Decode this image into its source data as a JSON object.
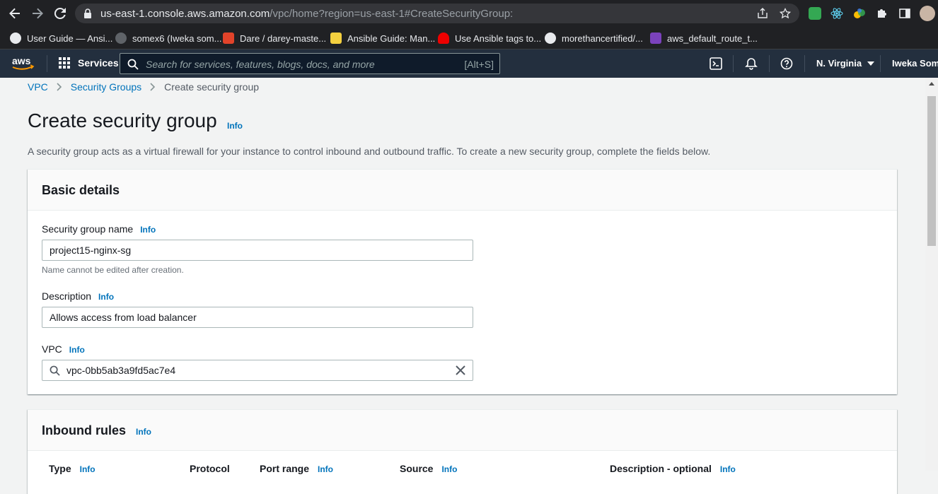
{
  "browser": {
    "url_host": "us-east-1.console.aws.amazon.com",
    "url_path": "/vpc/home?region=us-east-1#CreateSecurityGroup:",
    "bookmarks": [
      {
        "label": "User Guide — Ansi...",
        "icon": "ansible-icon"
      },
      {
        "label": "somex6 (Iweka som...",
        "icon": "github-icon"
      },
      {
        "label": "Dare / darey-maste...",
        "icon": "gitlab-icon"
      },
      {
        "label": "Ansible Guide: Man...",
        "icon": "ribbon-icon"
      },
      {
        "label": "Use Ansible tags to...",
        "icon": "redhat-icon"
      },
      {
        "label": "morethancertified/...",
        "icon": "github-icon"
      },
      {
        "label": "aws_default_route_t...",
        "icon": "terraform-icon"
      }
    ]
  },
  "aws_nav": {
    "services_label": "Services",
    "search_placeholder": "Search for services, features, blogs, docs, and more",
    "search_shortcut": "[Alt+S]",
    "region": "N. Virginia",
    "user": "Iweka Somto"
  },
  "breadcrumb": [
    "VPC",
    "Security Groups",
    "Create security group"
  ],
  "page": {
    "title": "Create security group",
    "info": "Info",
    "description": "A security group acts as a virtual firewall for your instance to control inbound and outbound traffic. To create a new security group, complete the fields below."
  },
  "basic_details": {
    "heading": "Basic details",
    "name_label": "Security group name",
    "name_value": "project15-nginx-sg",
    "name_hint": "Name cannot be edited after creation.",
    "description_label": "Description",
    "description_value": "Allows access from load balancer",
    "vpc_label": "VPC",
    "vpc_value": "vpc-0bb5ab3a9fd5ac7e4"
  },
  "inbound": {
    "heading": "Inbound rules",
    "columns": [
      "Type",
      "Protocol",
      "Port range",
      "Source",
      "Description - optional"
    ]
  },
  "colors": {
    "aws_bar": "#232f3e",
    "link": "#0073bb",
    "accent_orange": "#ff9900"
  }
}
